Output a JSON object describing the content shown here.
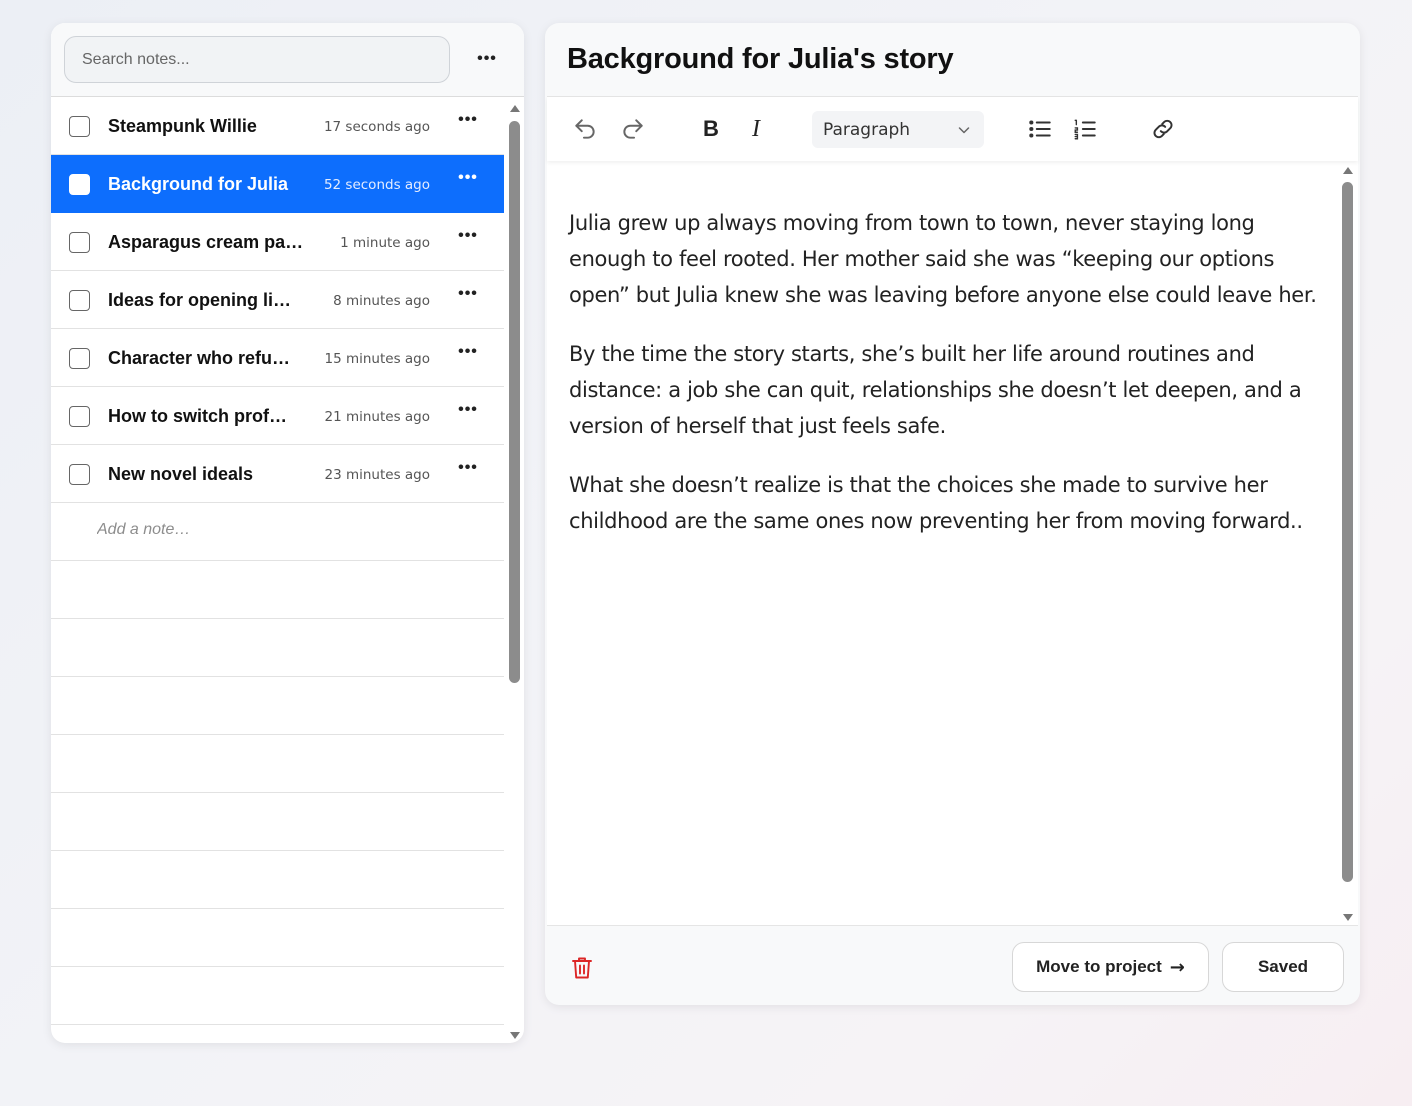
{
  "sidebar": {
    "search_placeholder": "Search notes...",
    "menu_label": "•••",
    "notes": [
      {
        "title": "Steampunk Willie",
        "time": "17 seconds ago",
        "selected": false
      },
      {
        "title": "Background for Julia",
        "time": "52 seconds ago",
        "selected": true
      },
      {
        "title": "Asparagus cream pa…",
        "time": "1 minute ago",
        "selected": false
      },
      {
        "title": "Ideas for opening li…",
        "time": "8 minutes ago",
        "selected": false
      },
      {
        "title": "Character who refu…",
        "time": "15 minutes ago",
        "selected": false
      },
      {
        "title": "How to switch prof…",
        "time": "21 minutes ago",
        "selected": false
      },
      {
        "title": "New novel ideals",
        "time": "23 minutes ago",
        "selected": false
      }
    ],
    "row_menu_label": "•••",
    "add_note_placeholder": "Add a note…"
  },
  "editor": {
    "title": "Background for Julia's story",
    "toolbar": {
      "undo_icon": "undo-icon",
      "redo_icon": "redo-icon",
      "bold_label": "B",
      "italic_label": "I",
      "format_value": "Paragraph",
      "bullet_list_icon": "bullet-list-icon",
      "numbered_list_icon": "numbered-list-icon",
      "link_icon": "link-icon"
    },
    "paragraphs": [
      "Julia grew up always moving from town to town, never staying long enough to feel rooted. Her mother said she was “keeping our options open” but Julia knew she was leaving before anyone else could leave her.",
      "By the time the story starts, she’s built her life around routines and distance: a job she can quit, relationships she doesn’t let deepen, and a version of herself that just feels safe.",
      "What she doesn’t realize is that the choices she made to survive her childhood are the same ones now preventing her from moving forward.."
    ],
    "footer": {
      "delete_icon": "trash-icon",
      "move_label": "Move to project",
      "move_arrow": "→",
      "saved_label": "Saved"
    }
  },
  "colors": {
    "accent": "#0d6efd",
    "danger": "#dc2626"
  }
}
